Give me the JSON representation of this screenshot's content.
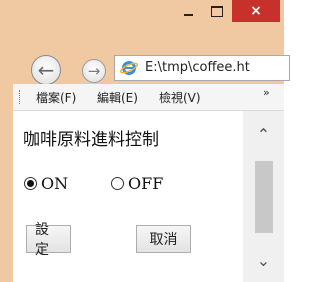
{
  "window": {
    "minimize_icon": "minimize-icon",
    "maximize_icon": "maximize-icon",
    "close_label": "×"
  },
  "nav": {
    "back_icon": "back-arrow-icon",
    "forward_icon": "forward-arrow-icon",
    "address": "E:\\tmp\\coffee.ht"
  },
  "menu": {
    "items": [
      "檔案(F)",
      "編輯(E)",
      "檢視(V)"
    ],
    "overflow": "»"
  },
  "form": {
    "title": "咖啡原料進料控制",
    "options": [
      {
        "label": "ON",
        "checked": true
      },
      {
        "label": "OFF",
        "checked": false
      }
    ],
    "submit_label": "設定",
    "cancel_label": "取消"
  },
  "colors": {
    "frame": "#f0c9a3",
    "close": "#c7302b"
  }
}
